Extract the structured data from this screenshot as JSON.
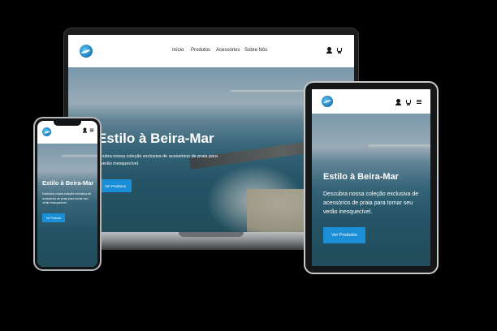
{
  "site": {
    "nav_links": [
      "Início",
      "Produtos",
      "Acessórios",
      "Sobre Nós"
    ],
    "logo_icon": "brand-logo-icon",
    "header_icons": [
      "user-icon",
      "cart-icon",
      "menu-icon"
    ]
  },
  "hero": {
    "title": "Estilo à Beira-Mar",
    "laptop_title": "Estilo à Beira-Mar",
    "laptop_description": "cubra nossa coleção exclusiva de acessórios de praia para verão inesquecível.",
    "description": "Descubra nossa coleção exclusiva de acessórios de praia para tornar seu verão inesquecível.",
    "phone_description": "Descubra nossa coleção exclusiva de acessórios de praia para tornar seu verão inesquecível.",
    "cta_label": "Ver Produtos"
  },
  "colors": {
    "accent": "#1a8fd8",
    "background": "#000000"
  }
}
